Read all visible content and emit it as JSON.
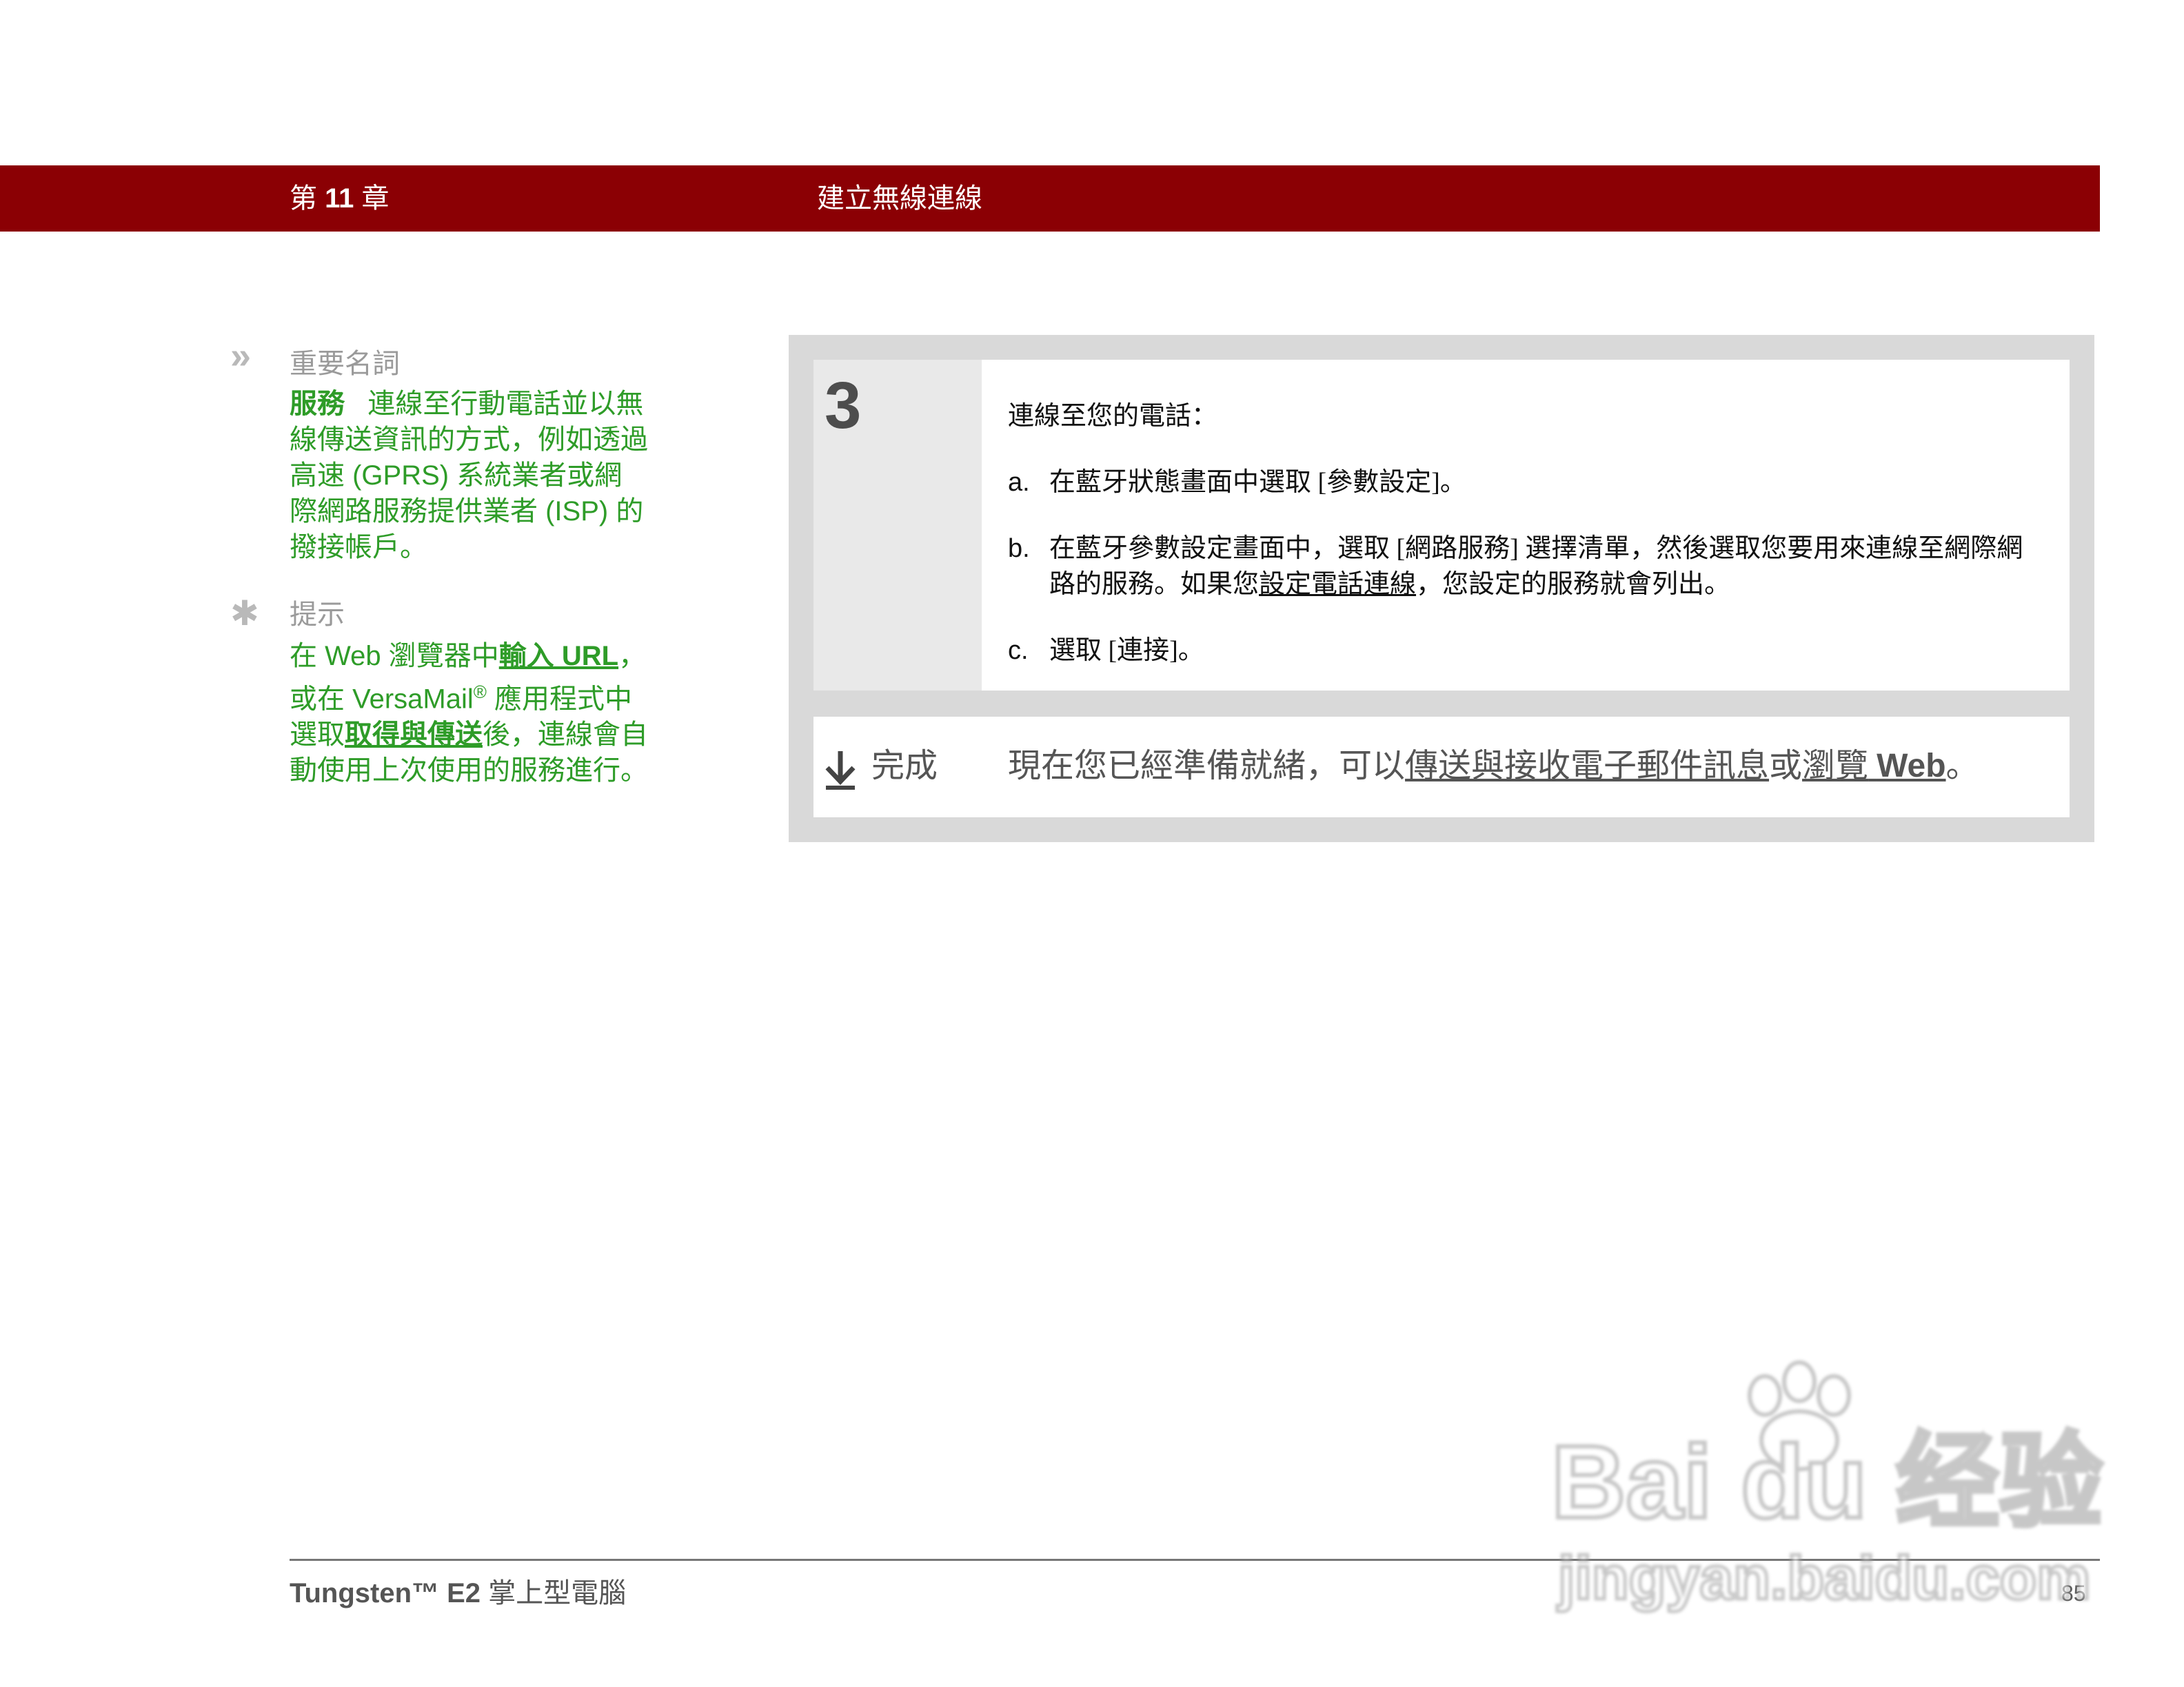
{
  "header": {
    "chapter_prefix": "第",
    "chapter_number": "11",
    "chapter_suffix": "章",
    "title": "建立無線連線",
    "bar_color": "#8b0004"
  },
  "sidebar": {
    "glossary": {
      "icon": "double-chevron-icon",
      "icon_glyph": "»",
      "heading": "重要名詞",
      "term": "服務",
      "definition": "連線至行動電話並以無線傳送資訊的方式，例如透過高速 (GPRS) 系統業者或網際網路服務提供業者 (ISP) 的撥接帳戶。"
    },
    "tip": {
      "icon": "asterisk-icon",
      "icon_glyph": "✱",
      "heading": "提示",
      "text_1": "在 Web 瀏覽器中",
      "link_1": "輸入 URL",
      "text_2": "，或在 VersaMail",
      "registered": "®",
      "text_3": " 應用程式中選取",
      "link_2": "取得與傳送",
      "text_4": "後，連線會自動使用上次使用的服務進行。"
    },
    "text_color": "#2e9c28"
  },
  "step": {
    "number": "3",
    "intro": "連線至您的電話：",
    "items": [
      {
        "letter": "a.",
        "text": "在藍牙狀態畫面中選取 [參數設定]。"
      },
      {
        "letter": "b.",
        "text_before": "在藍牙參數設定畫面中，選取 [網路服務] 選擇清單，然後選取您要用來連線至網際網路的服務。如果您",
        "link": "設定電話連線",
        "text_after": "，您設定的服務就會列出。"
      },
      {
        "letter": "c.",
        "text": "選取 [連接]。"
      }
    ]
  },
  "done": {
    "icon": "download-arrow-icon",
    "label": "完成",
    "text_before": "現在您已經準備就緒，可以",
    "link_1": "傳送與接收電子郵件訊息",
    "text_mid": "或",
    "link_2": "瀏覽",
    "link_2_web": "Web",
    "text_after": "。"
  },
  "footer": {
    "product_name": "Tungsten™ E2",
    "product_suffix": "掌上型電腦",
    "page_number": "85"
  },
  "watermark": {
    "main": "Bai du 经验",
    "sub": "jingyan.baidu.com"
  }
}
